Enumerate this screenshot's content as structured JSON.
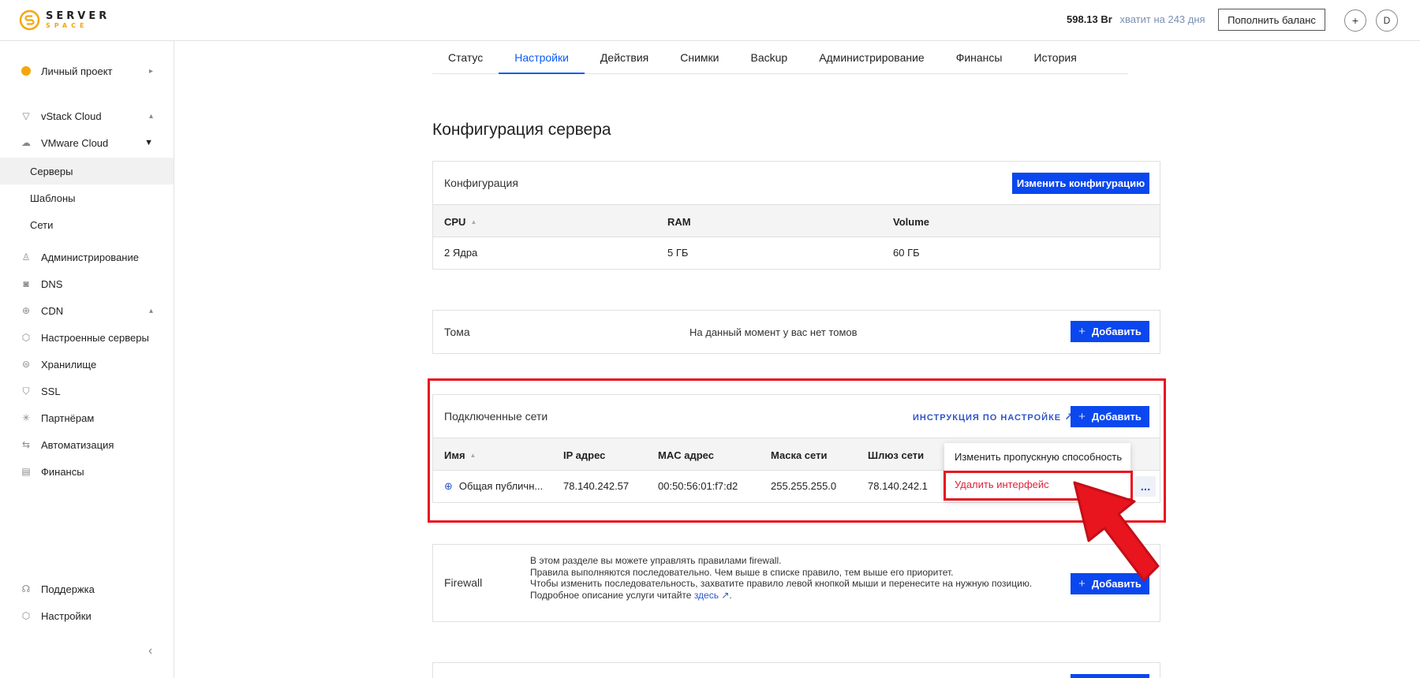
{
  "brand": {
    "line1": "SERVER",
    "line2": "SPACE"
  },
  "header": {
    "balance": "598.13 Br",
    "enough_text": "хватит на 243 дня",
    "topup_label": "Пополнить баланс",
    "avatar_letter": "D",
    "add_symbol": "+"
  },
  "sidebar": {
    "project": "Личный проект",
    "vstack": "vStack Cloud",
    "vmware": "VMware Cloud",
    "servers": "Серверы",
    "templates": "Шаблоны",
    "networks": "Сети",
    "admin": "Администрирование",
    "dns": "DNS",
    "cdn": "CDN",
    "tuned": "Настроенные серверы",
    "storage": "Хранилище",
    "ssl": "SSL",
    "partners": "Партнёрам",
    "automation": "Автоматизация",
    "finance": "Финансы",
    "support": "Поддержка",
    "settings": "Настройки"
  },
  "tabs": [
    "Статус",
    "Настройки",
    "Действия",
    "Снимки",
    "Backup",
    "Администрирование",
    "Финансы",
    "История"
  ],
  "page_title": "Конфигурация сервера",
  "config": {
    "title": "Конфигурация",
    "change_label": "Изменить конфигурацию",
    "headers": [
      "CPU",
      "RAM",
      "Volume"
    ],
    "values": [
      "2 Ядра",
      "5 ГБ",
      "60 ГБ"
    ]
  },
  "volumes": {
    "title": "Тома",
    "empty": "На данный момент у вас нет томов",
    "add_label": "Добавить"
  },
  "networks": {
    "title": "Подключенные сети",
    "instr_link": "ИНСТРУКЦИЯ ПО НАСТРОЙКЕ",
    "add_label": "Добавить",
    "headers": [
      "Имя",
      "IP адрес",
      "MAC адрес",
      "Маска сети",
      "Шлюз сети"
    ],
    "row": [
      "Общая публичн...",
      "78.140.242.57",
      "00:50:56:01:f7:d2",
      "255.255.255.0",
      "78.140.242.1"
    ]
  },
  "menu": {
    "change_bandwidth": "Изменить пропускную способность",
    "delete_interface": "Удалить интерфейс",
    "dots": "..."
  },
  "firewall": {
    "title": "Firewall",
    "line1": "В этом разделе вы можете управлять правилами firewall.",
    "line2": "Правила выполняются последовательно. Чем выше в списке правило, тем выше его приоритет.",
    "line3": "Чтобы изменить последовательность, захватите правило левой кнопкой мыши и перенесите на нужную позицию.",
    "line4": "Подробное описание услуги читайте",
    "link": "здесь",
    "add_label": "Добавить"
  },
  "colors": {
    "accent": "#0a47ef",
    "highlight": "#e8141e",
    "danger": "#e01f3a",
    "brand": "#f5a60c"
  }
}
